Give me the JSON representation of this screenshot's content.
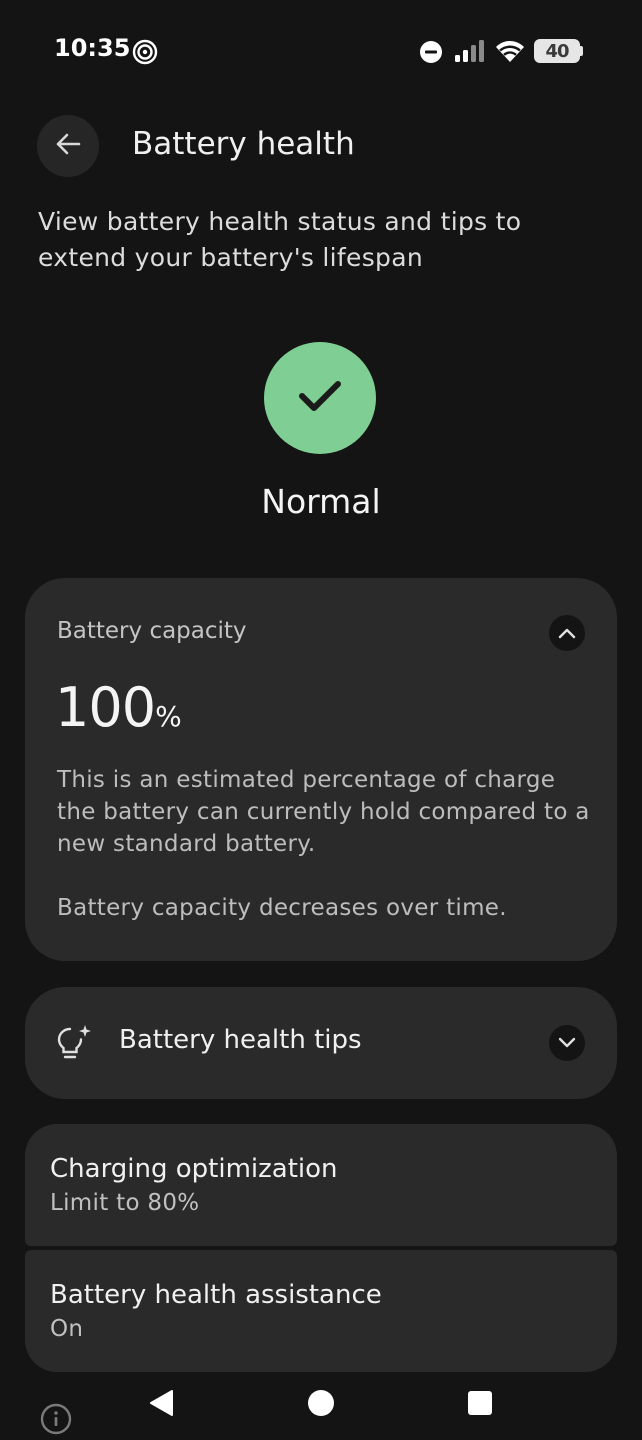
{
  "status_bar": {
    "time": "10:35",
    "battery_level": "40",
    "icons": [
      "hotspot-icon",
      "do-not-disturb-icon",
      "signal-icon",
      "wifi-icon",
      "battery-icon"
    ]
  },
  "header": {
    "title": "Battery health",
    "back_icon": "arrow-left-icon"
  },
  "subtitle": "View battery health status and tips to extend your battery's lifespan",
  "status": {
    "label": "Normal",
    "icon": "checkmark-icon",
    "color": "#7fcf94"
  },
  "capacity_card": {
    "label": "Battery capacity",
    "value": "100",
    "unit": "%",
    "description": "This is an estimated percentage of charge the battery can currently hold compared to a new standard battery.",
    "note": "Battery capacity decreases over time.",
    "toggle_icon": "chevron-up-icon"
  },
  "tips_card": {
    "label": "Battery health tips",
    "icon": "lightbulb-sparkle-icon",
    "toggle_icon": "chevron-down-icon"
  },
  "settings": [
    {
      "title": "Charging optimization",
      "subtitle": "Limit to 80%"
    },
    {
      "title": "Battery health assistance",
      "subtitle": "On"
    }
  ],
  "nav_bar": {
    "icons": [
      "info-icon",
      "nav-back-icon",
      "nav-home-icon",
      "nav-recents-icon"
    ]
  }
}
